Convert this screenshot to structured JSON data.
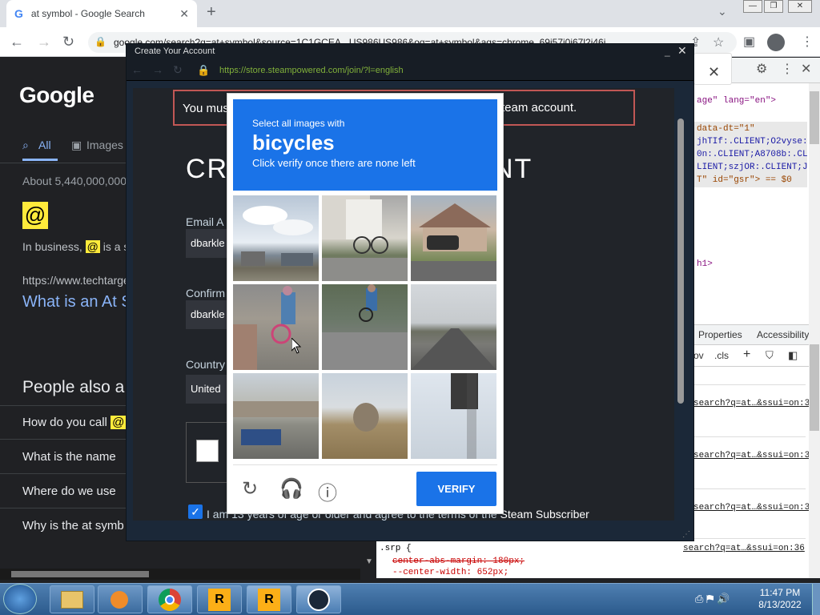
{
  "browser": {
    "tab_title": "at symbol - Google Search",
    "new_tab_icon": "+",
    "omnibox_text": "google.com/search?q=at+symbol&source=1C1GCEA...US986US986&oq=at+symbol&aqs=chrome..69i57j0i67l2j46i"
  },
  "google": {
    "logo": "Google",
    "tab_all": "All",
    "tab_images": "Images",
    "stats": "About 5,440,000,000",
    "at_glyph": "@",
    "snippet_pre": "In business,",
    "snippet_hl": "@",
    "snippet_post": "is a s",
    "result_url": "https://www.techtarget",
    "result_title": "What is an At S",
    "paa_title": "People also a",
    "paa_items": [
      "How do you call",
      "What is the name",
      "Where do we use",
      "Why is the at symb"
    ],
    "paa_hl": "@"
  },
  "devtools": {
    "lines": [
      "age\" lang=\"en\">",
      "data-dt=\"1\"",
      "jhTIf:.CLIENT;O2vyse:",
      "0n:.CLIENT;A8708b:.CL",
      "LIENT;szjOR:.CLIENT;J",
      "T\" id=\"gsr\"> == $0",
      "h1>"
    ],
    "tab_properties": "Properties",
    "tab_accessibility": "Accessibility",
    "tool_ov": "ov",
    "tool_cls": ".cls",
    "links": [
      "search?q=at…&ssui=on:36",
      "search?q=at…&ssui=on:36",
      "search?q=at…&ssui=on:36",
      "search?q=at…&ssui=on:36"
    ],
    "srp_selector": ".srp {",
    "srp_rule1": "center-abs-margin: 180px;",
    "srp_rule2": "--center-width: 652px;"
  },
  "steam": {
    "window_title": "Create Your Account",
    "url": "https://store.steampowered.com/join/?l=english",
    "warning_left": "You mus",
    "warning_right": "team account.",
    "heading_left": "CR",
    "heading_right": "NT",
    "email_label": "Email A",
    "email_value": "dbarkle",
    "confirm_label": "Confirm",
    "confirm_value": "dbarkle",
    "country_label": "Country",
    "country_value": "United",
    "agree_text": "I am 13 years of age or older and agree to the terms of the",
    "agree_bold": "Steam Subscriber"
  },
  "captcha": {
    "instruction_small": "Select all images with",
    "instruction_target": "bicycles",
    "instruction_sub": "Click verify once there are none left",
    "verify_label": "VERIFY",
    "tiles": [
      "sky-houses",
      "house-bike-rack",
      "house-car",
      "person-bicycle",
      "cyclist-street",
      "empty-road",
      "highway-truck",
      "field-trees",
      "traffic-light"
    ]
  },
  "taskbar": {
    "time": "11:47 PM",
    "date": "8/13/2022"
  },
  "colors": {
    "captcha_blue": "#1a73e8",
    "steam_bg": "#1b2838",
    "google_bg": "#202124",
    "link_blue": "#8ab4f8"
  }
}
